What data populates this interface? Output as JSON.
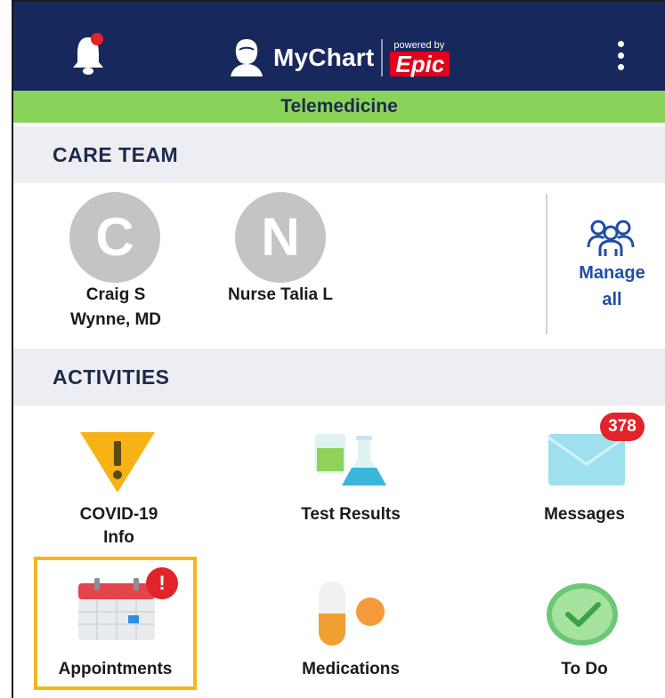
{
  "header": {
    "app_name": "MyChart",
    "powered_by": "powered by",
    "brand": "Epic",
    "bell_icon": "notification-bell-icon",
    "menu_icon": "kebab-menu-icon",
    "color": "#17285c"
  },
  "banner": {
    "text": "Telemedicine",
    "color": "#8ad35b"
  },
  "care_team": {
    "title": "CARE TEAM",
    "members": [
      {
        "initial": "C",
        "name_line1": "Craig S",
        "name_line2": "Wynne, MD"
      },
      {
        "initial": "N",
        "name_line1": "Nurse Talia L",
        "name_line2": ""
      }
    ],
    "manage": {
      "line1": "Manage",
      "line2": "all",
      "icon": "group-icon"
    }
  },
  "activities": {
    "title": "ACTIVITIES",
    "items": [
      {
        "label_line1": "COVID-19",
        "label_line2": "Info",
        "icon": "warning-icon"
      },
      {
        "label_line1": "Test Results",
        "label_line2": "",
        "icon": "beakers-icon"
      },
      {
        "label_line1": "Messages",
        "label_line2": "",
        "icon": "envelope-icon",
        "badge": "378"
      },
      {
        "label_line1": "Appointments",
        "label_line2": "",
        "icon": "calendar-icon",
        "badge": "!"
      },
      {
        "label_line1": "Medications",
        "label_line2": "",
        "icon": "pill-icon"
      },
      {
        "label_line1": "To Do",
        "label_line2": "",
        "icon": "checkmark-icon"
      }
    ]
  },
  "colors": {
    "badge": "#e2232a",
    "link": "#1f4ea8",
    "highlight": "#f6b51b"
  }
}
